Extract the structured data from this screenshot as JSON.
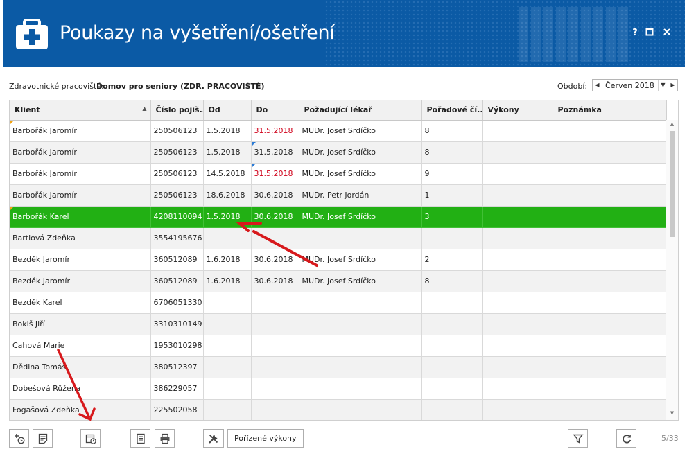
{
  "window": {
    "title": "Poukazy na vyšetření/ošetření",
    "help": "?",
    "maximize": "▣",
    "close": "✕"
  },
  "filter": {
    "workplace_label": "Zdravotnické pracoviště:",
    "workplace_value": "Domov pro seniory (ZDR. PRACOVIŠTĚ)",
    "period_label": "Období:",
    "period_value": "Červen 2018"
  },
  "grid": {
    "columns": [
      "Klient",
      "Číslo pojiš...",
      "Od",
      "Do",
      "Požadující lékař",
      "Pořadové čí...",
      "Výkony",
      "Poznámka"
    ],
    "sorted_column": "Klient",
    "rows": [
      {
        "klient": "Barbořák Jaromír",
        "cislo": "250506123",
        "od": "1.5.2018",
        "do": "31.5.2018",
        "lekar": "MUDr. Josef Srdíčko",
        "poradove": "8",
        "vykony": "",
        "poznamka": "",
        "do_red": true,
        "flag_orange": true,
        "flag_blue_do": false
      },
      {
        "klient": "Barbořák Jaromír",
        "cislo": "250506123",
        "od": "1.5.2018",
        "do": "31.5.2018",
        "lekar": "MUDr. Josef Srdíčko",
        "poradove": "8",
        "vykony": "",
        "poznamka": "",
        "do_red": false,
        "flag_orange": false,
        "flag_blue_do": true
      },
      {
        "klient": "Barbořák Jaromír",
        "cislo": "250506123",
        "od": "14.5.2018",
        "do": "31.5.2018",
        "lekar": "MUDr. Josef Srdíčko",
        "poradove": "9",
        "vykony": "",
        "poznamka": "",
        "do_red": true,
        "flag_orange": false,
        "flag_blue_do": true
      },
      {
        "klient": "Barbořák Jaromír",
        "cislo": "250506123",
        "od": "18.6.2018",
        "do": "30.6.2018",
        "lekar": "MUDr. Petr Jordán",
        "poradove": "1",
        "vykony": "",
        "poznamka": "",
        "do_red": false,
        "flag_orange": false,
        "flag_blue_do": false
      },
      {
        "klient": "Barbořák Karel",
        "cislo": "4208110094",
        "od": "1.5.2018",
        "do": "30.6.2018",
        "lekar": "MUDr. Josef Srdíčko",
        "poradove": "3",
        "vykony": "",
        "poznamka": "",
        "do_red": false,
        "flag_orange": true,
        "flag_blue_do": false,
        "selected": true
      },
      {
        "klient": "Bartlová Zdeňka",
        "cislo": "3554195676",
        "od": "",
        "do": "",
        "lekar": "",
        "poradove": "",
        "vykony": "",
        "poznamka": ""
      },
      {
        "klient": "Bezděk Jaromír",
        "cislo": "360512089",
        "od": "1.6.2018",
        "do": "30.6.2018",
        "lekar": "MUDr. Josef Srdíčko",
        "poradove": "2",
        "vykony": "",
        "poznamka": ""
      },
      {
        "klient": "Bezděk Jaromír",
        "cislo": "360512089",
        "od": "1.6.2018",
        "do": "30.6.2018",
        "lekar": "MUDr. Josef Srdíčko",
        "poradove": "8",
        "vykony": "",
        "poznamka": ""
      },
      {
        "klient": "Bezděk Karel",
        "cislo": "6706051330",
        "od": "",
        "do": "",
        "lekar": "",
        "poradove": "",
        "vykony": "",
        "poznamka": ""
      },
      {
        "klient": "Bokiš Jiří",
        "cislo": "3310310149",
        "od": "",
        "do": "",
        "lekar": "",
        "poradove": "",
        "vykony": "",
        "poznamka": ""
      },
      {
        "klient": "Cahová Marie",
        "cislo": "1953010298",
        "od": "",
        "do": "",
        "lekar": "",
        "poradove": "",
        "vykony": "",
        "poznamka": ""
      },
      {
        "klient": "Dědina Tomáš",
        "cislo": "380512397",
        "od": "",
        "do": "",
        "lekar": "",
        "poradove": "",
        "vykony": "",
        "poznamka": ""
      },
      {
        "klient": "Dobešová Růžena",
        "cislo": "386229057",
        "od": "",
        "do": "",
        "lekar": "",
        "poradove": "",
        "vykony": "",
        "poznamka": ""
      },
      {
        "klient": "Fogašová Zdeňka",
        "cislo": "225502058",
        "od": "",
        "do": "",
        "lekar": "",
        "poradove": "",
        "vykony": "",
        "poznamka": ""
      }
    ]
  },
  "toolbar": {
    "porizene_label": "Pořízené výkony",
    "page_info": "5/33"
  },
  "icons": [
    "medical-case-icon",
    "add-time-icon",
    "document-edit-icon",
    "calendar-clock-icon",
    "report-icon",
    "print-icon",
    "tools-icon",
    "filter-icon",
    "refresh-icon"
  ],
  "colors": {
    "header_bg": "#0b5aa5",
    "selected_row": "#22b014",
    "date_red": "#d0021b",
    "flag_orange": "#f2a516",
    "flag_blue": "#2b7bd6",
    "arrow_red": "#d7191c"
  }
}
